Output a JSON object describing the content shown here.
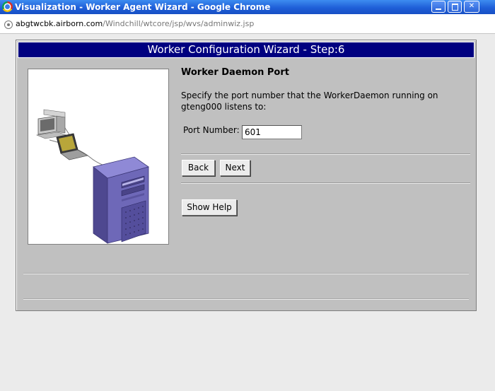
{
  "window": {
    "title": "Visualization - Worker Agent Wizard - Google Chrome",
    "min_symbol": "",
    "max_symbol": "",
    "close_symbol": "✕"
  },
  "address": {
    "host": "abgtwcbk.airborn.com",
    "path": "/Windchill/wtcore/jsp/wvs/adminwiz.jsp"
  },
  "wizard": {
    "header": "Worker Configuration Wizard - Step:6",
    "section_title": "Worker Daemon Port",
    "description": "Specify the port number that the WorkerDaemon running on gteng000 listens to:",
    "port_label": "Port Number:",
    "port_value": "601",
    "back_label": "Back",
    "next_label": "Next",
    "help_label": "Show Help"
  },
  "colors": {
    "titlebar": "#1f5fd8",
    "header_bg": "#000080",
    "panel_bg": "#c0c0c0",
    "server_purple": "#6e68b8"
  },
  "icons": [
    "chrome-logo-icon",
    "page-icon",
    "minimize-icon",
    "maximize-icon",
    "close-icon"
  ]
}
